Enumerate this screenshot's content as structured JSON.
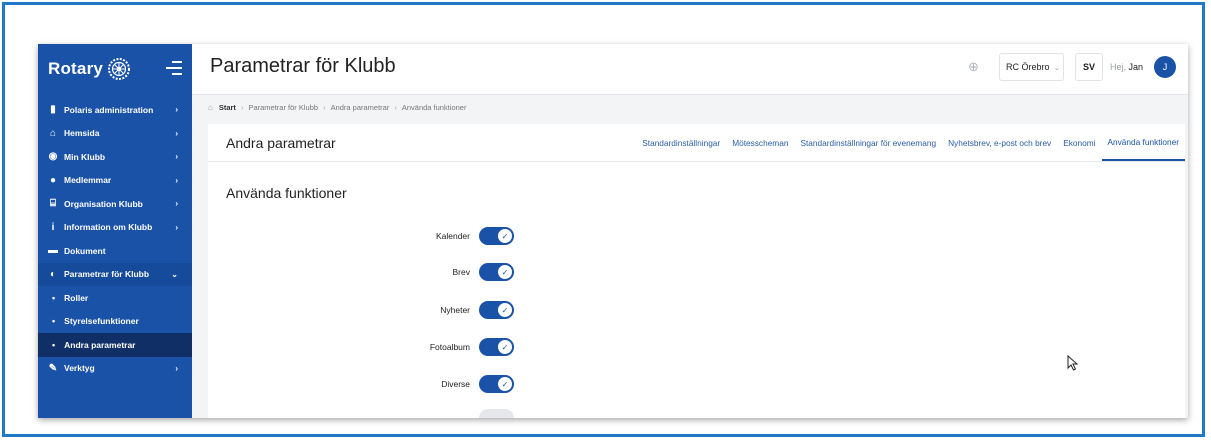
{
  "sidebar": {
    "logo_text": "Rotary",
    "items": [
      {
        "label": "Polaris administration",
        "chevron": "›"
      },
      {
        "label": "Hemsida",
        "chevron": "›"
      },
      {
        "label": "Min Klubb",
        "chevron": "›"
      },
      {
        "label": "Medlemmar",
        "chevron": "›"
      },
      {
        "label": "Organisation Klubb",
        "chevron": "›"
      },
      {
        "label": "Information om Klubb",
        "chevron": "›"
      },
      {
        "label": "Dokument",
        "chevron": ""
      },
      {
        "label": "Parametrar för Klubb",
        "chevron": "⌄"
      },
      {
        "label": "Roller",
        "chevron": ""
      },
      {
        "label": "Styrelsefunktioner",
        "chevron": ""
      },
      {
        "label": "Andra parametrar",
        "chevron": ""
      },
      {
        "label": "Verktyg",
        "chevron": "›"
      }
    ]
  },
  "header": {
    "title": "Parametrar för Klubb",
    "club": "RC Örebro",
    "language": "SV",
    "greeting_prefix": "Hej,",
    "user_name": "Jan",
    "avatar_initial": "J"
  },
  "breadcrumb": {
    "items": [
      "Start",
      "Parametrar för Klubb",
      "Andra parametrar",
      "Använda funktioner"
    ]
  },
  "card": {
    "title": "Andra parametrar",
    "tabs": [
      "Standardinställningar",
      "Mötesscheman",
      "Standardinställningar för evenemang",
      "Nyhetsbrev, e-post och brev",
      "Ekonomi",
      "Använda funktioner"
    ],
    "active_tab": "Använda funktioner",
    "section_title": "Använda funktioner",
    "toggles": [
      {
        "label": "Kalender",
        "on": true
      },
      {
        "label": "Brev",
        "on": true
      },
      {
        "label": "Nyheter",
        "on": true
      },
      {
        "label": "Fotoalbum",
        "on": true
      },
      {
        "label": "Diverse",
        "on": true
      }
    ]
  },
  "colors": {
    "brand": "#1a52a8",
    "sidebar_active": "#0f2f66",
    "frame": "#1f78c8"
  }
}
